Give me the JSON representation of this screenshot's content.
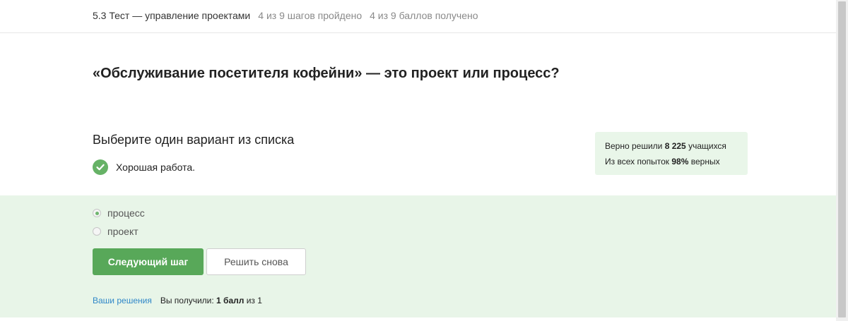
{
  "header": {
    "lesson_title": "5.3 Тест — управление проектами",
    "steps_progress": "4 из 9 шагов пройдено",
    "points_progress": "4 из 9 баллов  получено"
  },
  "question": {
    "text": "«Обслуживание посетителя кофейни» — это проект или процесс?",
    "instruction": "Выберите один вариант из списка"
  },
  "feedback": {
    "message": "Хорошая работа.",
    "icon": "check-circle-icon",
    "color": "#66b266"
  },
  "stats": {
    "line1_prefix": "Верно решили ",
    "solved_count": "8 225",
    "line1_suffix": " учащихся",
    "line2_prefix": "Из всех попыток ",
    "success_rate": "98%",
    "line2_suffix": " верных"
  },
  "options": [
    {
      "label": "процесс",
      "selected": true
    },
    {
      "label": "проект",
      "selected": false
    }
  ],
  "buttons": {
    "next_label": "Следующий шаг",
    "retry_label": "Решить снова"
  },
  "footer": {
    "solutions_link": "Ваши решения",
    "score_prefix": "Вы получили: ",
    "score_value": "1 балл",
    "score_suffix": " из 1"
  },
  "colors": {
    "accent_green": "#58a859",
    "panel_bg": "#e8f5e8",
    "stats_bg": "#e9f6e9",
    "link": "#2f87c8"
  }
}
